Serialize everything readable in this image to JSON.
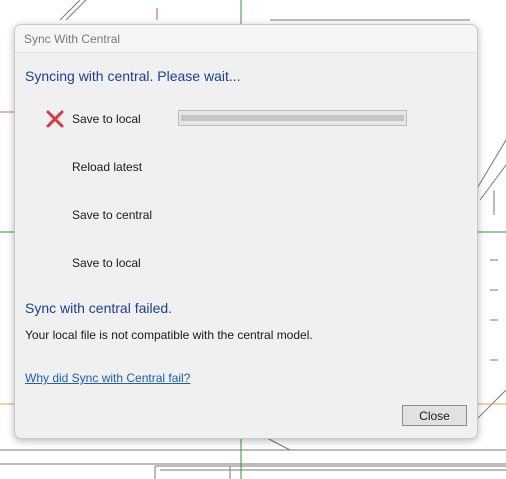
{
  "dialog": {
    "title": "Sync With Central",
    "status_heading": "Syncing with central. Please wait...",
    "steps": [
      {
        "label": "Save to local",
        "state": "error",
        "icon": "red-x-icon"
      },
      {
        "label": "Reload latest",
        "state": "pending"
      },
      {
        "label": "Save to central",
        "state": "pending"
      },
      {
        "label": "Save to local",
        "state": "pending"
      }
    ],
    "progress_fraction": 1.0,
    "fail_heading": "Sync with central failed.",
    "fail_detail": "Your local file is not compatible with the central model.",
    "help_link": "Why did Sync with Central fail?",
    "close_label": "Close"
  },
  "colors": {
    "heading": "#1c3f94",
    "link": "#1a5fb4",
    "error_icon": "#d9363e"
  }
}
